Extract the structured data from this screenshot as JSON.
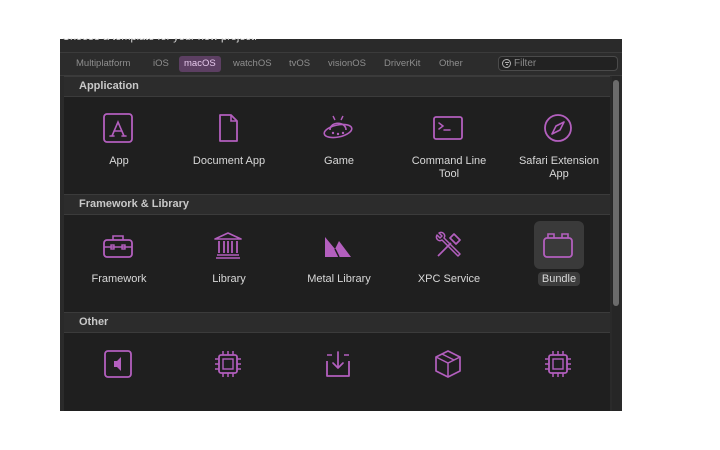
{
  "prompt": "Choose a template for your new project:",
  "colors": {
    "accent": "#b35fbe",
    "active_tab_bg": "#5c3f62"
  },
  "tabs": [
    {
      "label": "Multiplatform",
      "active": false
    },
    {
      "label": "iOS",
      "active": false
    },
    {
      "label": "macOS",
      "active": true
    },
    {
      "label": "watchOS",
      "active": false
    },
    {
      "label": "tvOS",
      "active": false
    },
    {
      "label": "visionOS",
      "active": false
    },
    {
      "label": "DriverKit",
      "active": false
    },
    {
      "label": "Other",
      "active": false
    }
  ],
  "filter": {
    "placeholder": "Filter",
    "value": "",
    "icon": "filter-icon"
  },
  "sections": [
    {
      "title": "Application",
      "items": [
        {
          "label": "App",
          "icon": "app-store-icon"
        },
        {
          "label": "Document App",
          "icon": "document-icon"
        },
        {
          "label": "Game",
          "icon": "game-icon"
        },
        {
          "label": "Command Line\nTool",
          "icon": "terminal-icon"
        },
        {
          "label": "Safari Extension\nApp",
          "icon": "compass-icon"
        }
      ]
    },
    {
      "title": "Framework & Library",
      "items": [
        {
          "label": "Framework",
          "icon": "toolbox-icon"
        },
        {
          "label": "Library",
          "icon": "library-icon"
        },
        {
          "label": "Metal Library",
          "icon": "metal-icon"
        },
        {
          "label": "XPC Service",
          "icon": "tools-icon"
        },
        {
          "label": "Bundle",
          "icon": "bundle-icon",
          "selected": true
        }
      ]
    },
    {
      "title": "Other",
      "items": [
        {
          "label": "",
          "icon": "speaker-icon"
        },
        {
          "label": "",
          "icon": "chip-icon"
        },
        {
          "label": "",
          "icon": "tray-download-icon"
        },
        {
          "label": "",
          "icon": "package-icon"
        },
        {
          "label": "",
          "icon": "chip-icon"
        }
      ]
    }
  ]
}
